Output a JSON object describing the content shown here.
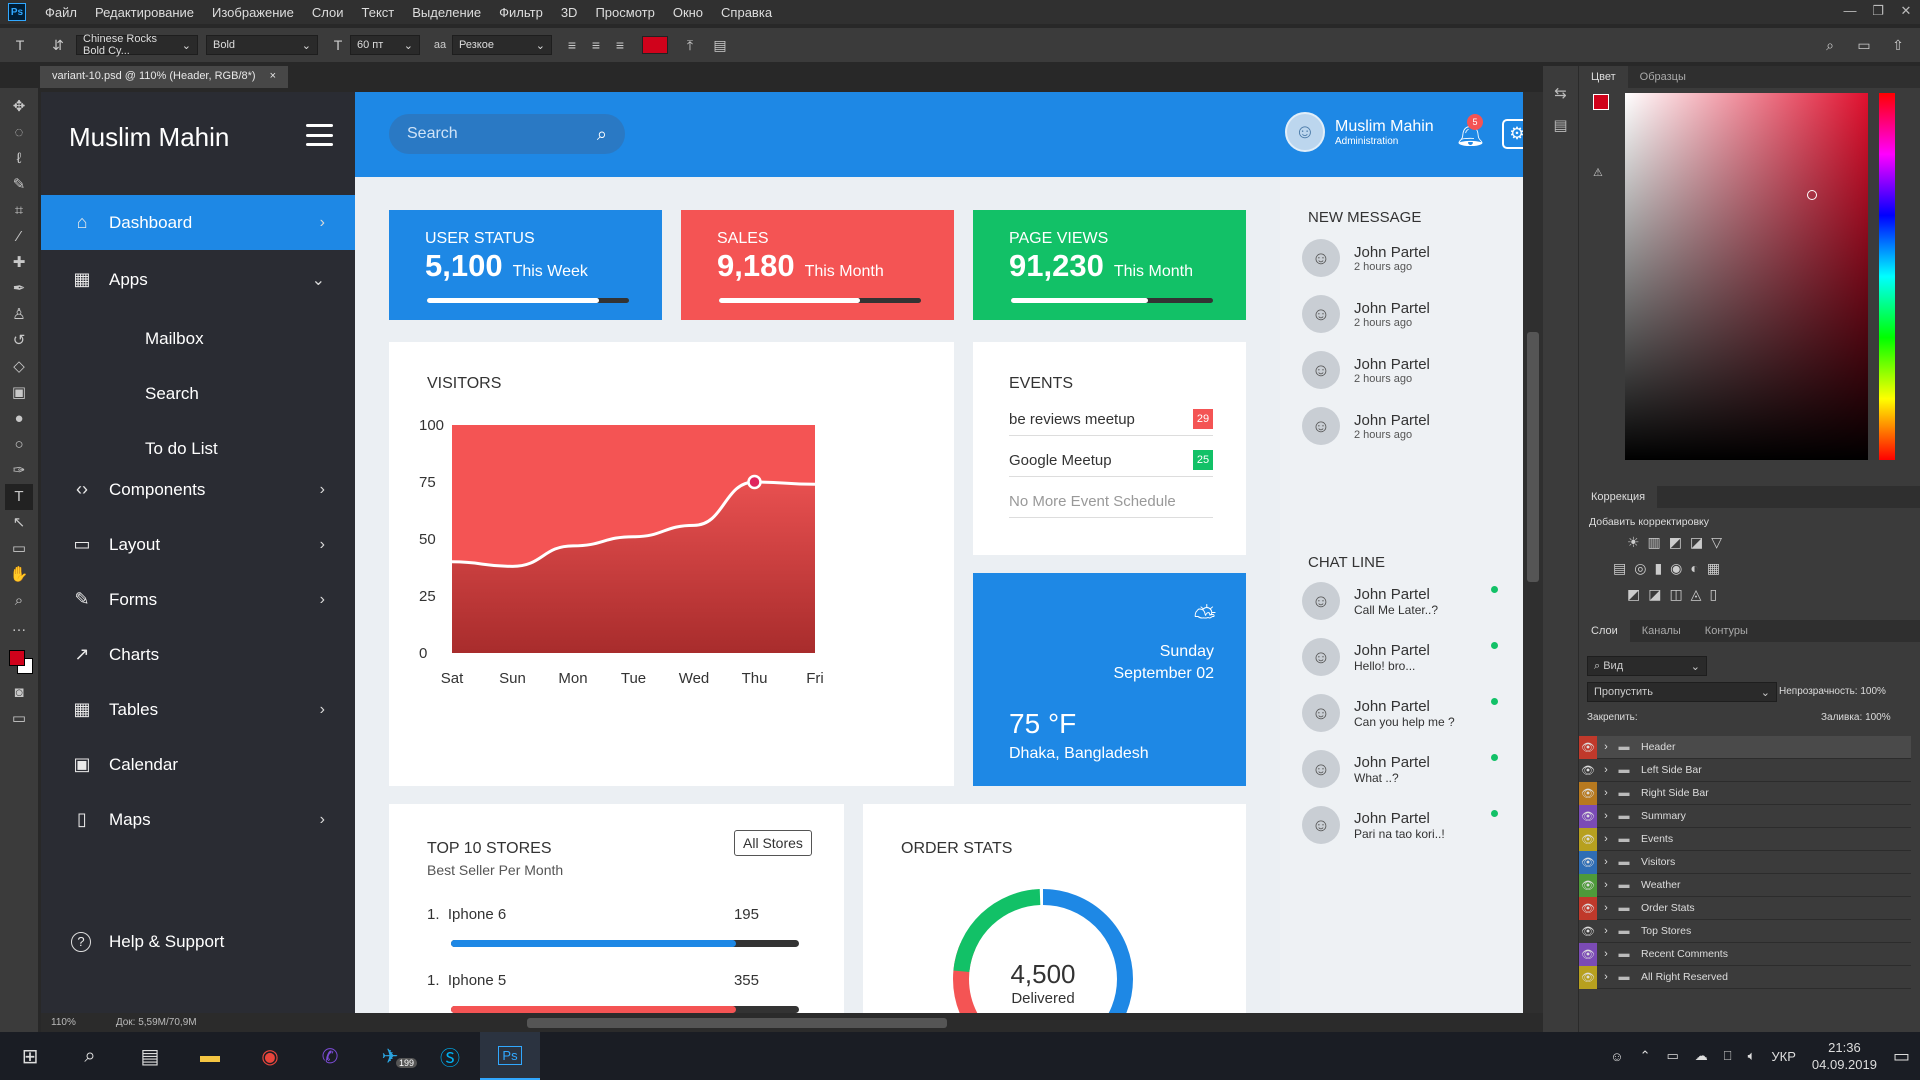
{
  "menu": [
    "Файл",
    "Редактирование",
    "Изображение",
    "Слои",
    "Текст",
    "Выделение",
    "Фильтр",
    "3D",
    "Просмотр",
    "Окно",
    "Справка"
  ],
  "options": {
    "font": "Chinese Rocks Bold Cy...",
    "style": "Bold",
    "size": "60 пт",
    "aa": "Резкое",
    "aa_label": "aa"
  },
  "doc_tab": {
    "label": "variant-10.psd @ 110% (Header, RGB/8*)",
    "close": "×"
  },
  "sidebar": {
    "brand": "Muslim Mahin",
    "items": [
      {
        "label": "Dashboard",
        "icon": "⌂"
      },
      {
        "label": "Apps",
        "icon": "▦"
      },
      {
        "label": "Components",
        "icon": "‹›"
      },
      {
        "label": "Layout",
        "icon": "▭"
      },
      {
        "label": "Forms",
        "icon": "✎"
      },
      {
        "label": "Charts",
        "icon": "↗"
      },
      {
        "label": "Tables",
        "icon": "▦"
      },
      {
        "label": "Calendar",
        "icon": "▣"
      },
      {
        "label": "Maps",
        "icon": "▯"
      },
      {
        "label": "Help & Support",
        "icon": "?"
      }
    ],
    "sub_items": [
      "Mailbox",
      "Search",
      "To do List"
    ]
  },
  "header": {
    "search_placeholder": "Search",
    "user_name": "Muslim Mahin",
    "user_role": "Administration",
    "notifications": "5"
  },
  "stats": [
    {
      "label": "USER STATUS",
      "value": "5,100",
      "suffix": "This Week",
      "progress": 0.85,
      "color": "#1e88e5"
    },
    {
      "label": "SALES",
      "value": "9,180",
      "suffix": "This Month",
      "progress": 0.7,
      "color": "#f45454"
    },
    {
      "label": "PAGE VIEWS",
      "value": "91,230",
      "suffix": "This Month",
      "progress": 0.68,
      "color": "#12c167"
    }
  ],
  "chart_data": {
    "type": "area",
    "title": "VISITORS",
    "categories": [
      "Sat",
      "Sun",
      "Mon",
      "Tue",
      "Wed",
      "Thu",
      "Fri"
    ],
    "y_ticks": [
      "100",
      "75",
      "50",
      "25",
      "0"
    ],
    "ylim": [
      0,
      100
    ],
    "values": [
      40,
      38,
      47,
      51,
      56,
      75,
      74
    ],
    "highlight_index": 5
  },
  "events": {
    "title": "EVENTS",
    "items": [
      {
        "label": "be reviews meetup",
        "badge": "29",
        "color": "#f45454"
      },
      {
        "label": "Google Meetup",
        "badge": "25",
        "color": "#12c167"
      }
    ],
    "empty": "No More Event Schedule"
  },
  "weather": {
    "day": "Sunday",
    "date": "September 02",
    "temp": "75",
    "unit": "°F",
    "location": "Dhaka, Bangladesh"
  },
  "stores": {
    "title": "TOP 10 STORES",
    "subtitle": "Best Seller Per Month",
    "button": "All Stores",
    "items": [
      {
        "rank": "1.",
        "name": "Iphone 6",
        "value": "195",
        "progress": 0.82,
        "color": "#1e88e5"
      },
      {
        "rank": "1.",
        "name": "Iphone 5",
        "value": "355",
        "progress": 0.82,
        "color": "#f45454"
      }
    ]
  },
  "orders": {
    "title": "ORDER STATS",
    "value": "4,500",
    "label": "Delivered"
  },
  "messages": {
    "title": "NEW MESSAGE",
    "items": [
      {
        "name": "John Partel",
        "time": "2 hours ago"
      },
      {
        "name": "John Partel",
        "time": "2 hours ago"
      },
      {
        "name": "John Partel",
        "time": "2 hours ago"
      },
      {
        "name": "John Partel",
        "time": "2 hours ago"
      }
    ]
  },
  "chat": {
    "title": "CHAT LINE",
    "items": [
      {
        "name": "John Partel",
        "text": "Call Me Later..?"
      },
      {
        "name": "John Partel",
        "text": "Hello! bro..."
      },
      {
        "name": "John Partel",
        "text": "Can you help me ?"
      },
      {
        "name": "John Partel",
        "text": "What ..?"
      },
      {
        "name": "John Partel",
        "text": "Pari na tao kori..!"
      }
    ]
  },
  "panel": {
    "color_tabs": [
      "Цвет",
      "Образцы"
    ],
    "correction_tab": "Коррекция",
    "add_correction": "Добавить корректировку",
    "layer_tabs": [
      "Слои",
      "Каналы",
      "Контуры"
    ],
    "kind": "Вид",
    "blend": "Пропустить",
    "opacity_label": "Непрозрачность:",
    "opacity": "100%",
    "lock_label": "Закрепить:",
    "fill_label": "Заливка:",
    "fill": "100%",
    "layers": [
      {
        "name": "Header",
        "color": "#c0392b"
      },
      {
        "name": "Left Side Bar",
        "color": "#3b3b3b"
      },
      {
        "name": "Right Side Bar",
        "color": "#b7791f"
      },
      {
        "name": "Summary",
        "color": "#7b4bb5"
      },
      {
        "name": "Events",
        "color": "#b7a01f"
      },
      {
        "name": "Visitors",
        "color": "#2f6db5"
      },
      {
        "name": "Weather",
        "color": "#4e9a3a"
      },
      {
        "name": "Order Stats",
        "color": "#c0392b"
      },
      {
        "name": "Top Stores",
        "color": "#3b3b3b"
      },
      {
        "name": "Recent Comments",
        "color": "#7b4bb5"
      },
      {
        "name": "All Right Reserved",
        "color": "#b7a01f"
      }
    ]
  },
  "status": {
    "zoom": "110%",
    "doc": "Док: 5,59M/70,9M"
  },
  "taskbar": {
    "lang": "УКР",
    "time": "21:36",
    "date": "04.09.2019",
    "telegram_badge": "199"
  }
}
